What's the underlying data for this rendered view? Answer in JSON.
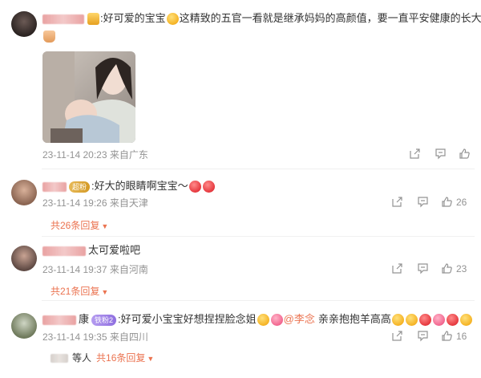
{
  "comments": [
    {
      "text": ":好可爱的宝宝",
      "text2": "这精致的五官一看就是继承妈妈的高颜值，要一直平安健康的长大",
      "time": "23-11-14 20:23",
      "location": "来自广东",
      "likes": "",
      "replies": ""
    },
    {
      "badge": "超粉",
      "text": ":好大的眼睛啊宝宝～",
      "time": "23-11-14 19:26",
      "location": "来自天津",
      "likes": "26",
      "replies": "共26条回复"
    },
    {
      "text": "太可爱啦吧",
      "time": "23-11-14 19:37",
      "location": "来自河南",
      "likes": "23",
      "replies": "共21条回复"
    },
    {
      "name_suffix": "康",
      "badge": "铁粉2",
      "text": ":好可爱小宝宝好想捏捏脸念姐",
      "mention": "@李念",
      "text3": "亲亲抱抱羊高高",
      "time": "23-11-14 19:35",
      "location": "来自四川",
      "likes": "16",
      "reply_who": "等人",
      "replies": "共16条回复"
    }
  ],
  "colors": {
    "accent": "#eb7350",
    "meta": "#939393"
  },
  "icons": [
    "share-icon",
    "comment-icon",
    "like-icon",
    "caret-down-icon"
  ]
}
